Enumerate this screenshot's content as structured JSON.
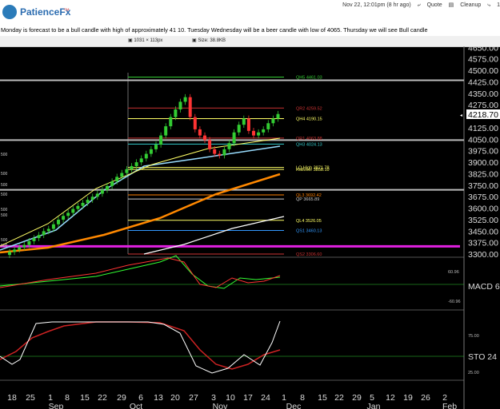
{
  "app": {
    "brand": "PatienceFx",
    "brand_mark": "™",
    "datetime": "Nov 22, 12:01pm (8 hr ago)",
    "actions": [
      "Quote",
      "Cleanup"
    ],
    "extra": "1"
  },
  "message": "Monday is forecast to be a bull candle with high of approximately 41 10. Tuesday Wednesday will be a beer candle with low of 4065. Thursday we will see Bull candle",
  "image_info": {
    "dimensions": "1031 × 113px",
    "size": "Size: 38.8KB"
  },
  "chart_data": {
    "type": "candlestick",
    "price_axis": {
      "ticks": [
        "4650.00",
        "4575.00",
        "4500.00",
        "4425.00",
        "4350.00",
        "4275.00",
        "4125.00",
        "4050.00",
        "3975.00",
        "3900.00",
        "3825.00",
        "3750.00",
        "3675.00",
        "3600.00",
        "3525.00",
        "3450.00",
        "3375.00",
        "3300.00"
      ],
      "range": [
        3285,
        4662
      ],
      "current": "4218.70"
    },
    "time_axis": {
      "days": [
        "18",
        "25",
        "1",
        "8",
        "15",
        "22",
        "29",
        "6",
        "13",
        "20",
        "27",
        "3",
        "10",
        "17",
        "24",
        "1",
        "8",
        "15",
        "22",
        "29",
        "5",
        "12",
        "19",
        "26",
        "2"
      ],
      "months": [
        "Sep",
        "Oct",
        "Nov",
        "Dec",
        "Jan",
        "Feb"
      ]
    },
    "levels": [
      {
        "label": "QH5 4461.03",
        "price": 4461,
        "color": "#33cc33"
      },
      {
        "label": "QR2 4259.52",
        "price": 4259,
        "color": "#cc3333"
      },
      {
        "label": "QH4 4190.15",
        "price": 4190,
        "color": "#ffff66"
      },
      {
        "label": "QR1 4063.88",
        "price": 4063,
        "color": "#cc3333"
      },
      {
        "label": "QH3 4024.13",
        "price": 4024,
        "color": "#33cccc"
      },
      {
        "label": "LQ High 3871.78",
        "price": 3871,
        "color": "#ffff66"
      },
      {
        "label": "Rollover 3858.10",
        "price": 3858,
        "color": "#ffff66"
      },
      {
        "label": "QL3 3692.42",
        "price": 3692,
        "color": "#ff7f00"
      },
      {
        "label": "QP 3665.89",
        "price": 3665,
        "color": "#cccccc"
      },
      {
        "label": "QL4 3526.05",
        "price": 3526,
        "color": "#ffff66"
      },
      {
        "label": "QS1 3460.13",
        "price": 3460,
        "color": "#3399ff"
      },
      {
        "label": "QS2 3306.60",
        "price": 3306,
        "color": "#cc3333"
      }
    ],
    "side_labels": [
      "500",
      "500",
      "500",
      "500",
      "500",
      "500",
      "500",
      "500"
    ],
    "macd": {
      "label": "MACD 6",
      "levels": [
        "60.96",
        "-60.96"
      ]
    },
    "sto": {
      "label": "STO 24",
      "levels": [
        "75.00",
        "25.00"
      ]
    }
  }
}
